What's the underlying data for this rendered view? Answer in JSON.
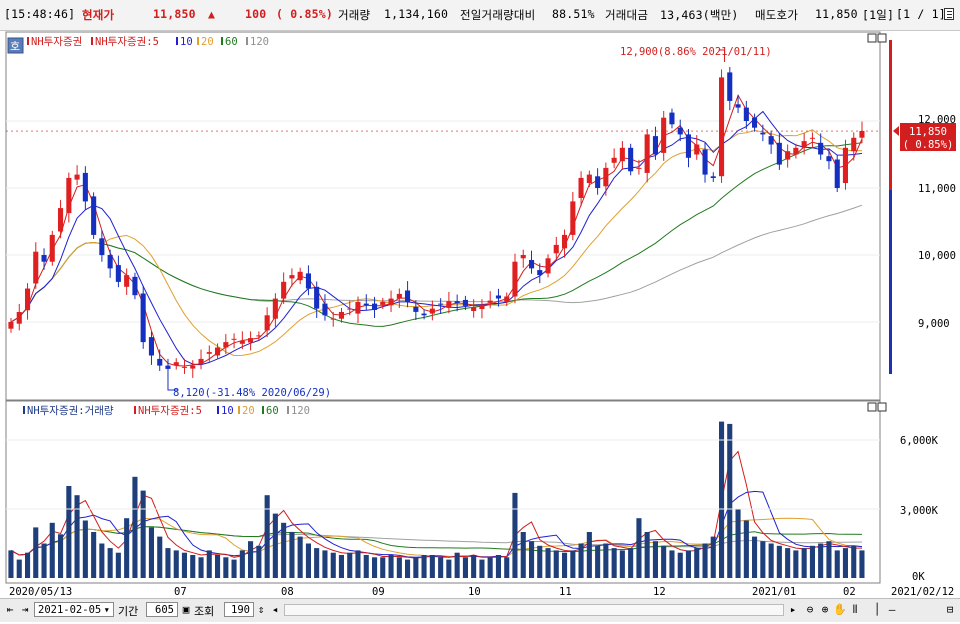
{
  "header": {
    "time": "[15:48:46]",
    "price_label": "현재가",
    "price": "11,850",
    "change_arrow": "▲",
    "change": "100",
    "change_pct": "( 0.85%)",
    "volume_label": "거래량",
    "volume": "1,134,160",
    "prev_vol_label": "전일거래량대비",
    "prev_vol_pct": "88.51%",
    "amount_label": "거래대금",
    "amount": "13,463(백만)",
    "ask_label": "매도호가",
    "ask": "11,850",
    "period": "[1일]",
    "page": "[1 / 1]",
    "menu_icon": "list-icon"
  },
  "price_panel": {
    "badge": "호",
    "legend": [
      {
        "text": "NH투자증권",
        "color": "#d21e1e"
      },
      {
        "text": "NH투자증권:5",
        "color": "#d21e1e"
      },
      {
        "text": "10",
        "color": "#2020d0"
      },
      {
        "text": "20",
        "color": "#e0a030"
      },
      {
        "text": "60",
        "color": "#207a20"
      },
      {
        "text": "120",
        "color": "#909090"
      }
    ],
    "high_annotation": "12,900(8.86% 2021/01/11)",
    "low_annotation": "8,120(-31.48% 2020/06/29)",
    "y_ticks": [
      "12,000",
      "11,000",
      "10,000",
      "9,000"
    ],
    "current_price_tag": "11,850",
    "current_change_tag": "( 0.85%)"
  },
  "volume_panel": {
    "legend": [
      {
        "text": "NH투자증권:거래량",
        "color": "#1e3a8a"
      },
      {
        "text": "NH투자증권:5",
        "color": "#d21e1e"
      },
      {
        "text": "10",
        "color": "#2020d0"
      },
      {
        "text": "20",
        "color": "#e0a030"
      },
      {
        "text": "60",
        "color": "#207a20"
      },
      {
        "text": "120",
        "color": "#909090"
      }
    ],
    "y_ticks": [
      "6,000K",
      "3,000K",
      "0K"
    ]
  },
  "x_axis": {
    "labels": [
      "2020/05/13",
      "07",
      "08",
      "09",
      "10",
      "11",
      "12",
      "2021/01",
      "02"
    ],
    "end_label": "2021/02/12"
  },
  "footer": {
    "date": "2021-02-05",
    "period_label": "기간",
    "period_value": "605",
    "view_label": "조회",
    "view_value": "190"
  },
  "chart_data": {
    "type": "candlestick",
    "y_range_price": [
      8000,
      13000
    ],
    "y_range_volume_k": [
      0,
      7000
    ],
    "high": {
      "value": 12900,
      "date": "2021/01/11",
      "pct": 8.86
    },
    "low": {
      "value": 8120,
      "date": "2020/06/29",
      "pct": -31.48
    },
    "close": [
      9000,
      9150,
      9500,
      10050,
      9900,
      10300,
      10700,
      11150,
      11200,
      10800,
      10300,
      10000,
      9800,
      9600,
      9700,
      9400,
      8700,
      8500,
      8350,
      8300,
      8400,
      8330,
      8350,
      8450,
      8550,
      8620,
      8700,
      8750,
      8720,
      8760,
      8800,
      9100,
      9350,
      9600,
      9700,
      9750,
      9500,
      9200,
      9100,
      9050,
      9150,
      9200,
      9300,
      9250,
      9180,
      9300,
      9350,
      9420,
      9300,
      9150,
      9100,
      9200,
      9260,
      9310,
      9280,
      9240,
      9220,
      9260,
      9320,
      9350,
      9380,
      9900,
      10000,
      9800,
      9700,
      9950,
      10150,
      10300,
      10800,
      11150,
      11200,
      11000,
      11300,
      11450,
      11600,
      11250,
      11300,
      11800,
      11500,
      12050,
      11950,
      11800,
      11450,
      11650,
      11200,
      11150,
      12650,
      12300,
      12200,
      12000,
      11900,
      11800,
      11650,
      11350,
      11550,
      11600,
      11700,
      11750,
      11500,
      11400,
      11000,
      11600,
      11750,
      11850
    ],
    "volume_k": [
      1200,
      800,
      1100,
      2200,
      1500,
      2400,
      1900,
      4000,
      3600,
      2500,
      2000,
      1500,
      1300,
      1100,
      2600,
      4400,
      3800,
      2200,
      1800,
      1300,
      1200,
      1100,
      1000,
      900,
      1200,
      1000,
      900,
      800,
      1200,
      1600,
      1400,
      3600,
      2800,
      2400,
      2000,
      1800,
      1500,
      1300,
      1200,
      1100,
      1000,
      1100,
      1200,
      1000,
      900,
      900,
      1000,
      900,
      800,
      900,
      1000,
      1000,
      900,
      800,
      1100,
      900,
      1000,
      800,
      900,
      1000,
      900,
      3700,
      2000,
      1600,
      1400,
      1300,
      1200,
      1100,
      1200,
      1500,
      2000,
      1400,
      1500,
      1300,
      1200,
      1300,
      2600,
      2000,
      1600,
      1400,
      1200,
      1100,
      1200,
      1300,
      1500,
      1800,
      6800,
      6700,
      3000,
      2500,
      1800,
      1600,
      1500,
      1400,
      1300,
      1200,
      1300,
      1400,
      1500,
      1600,
      1200,
      1300,
      1400,
      1200
    ],
    "ma_colors": {
      "ma5": "#d21e1e",
      "ma10": "#2020d0",
      "ma20": "#e0a030",
      "ma60": "#207a20",
      "ma120": "#909090"
    },
    "up_color": "#e02020",
    "down_color": "#1530c0"
  }
}
